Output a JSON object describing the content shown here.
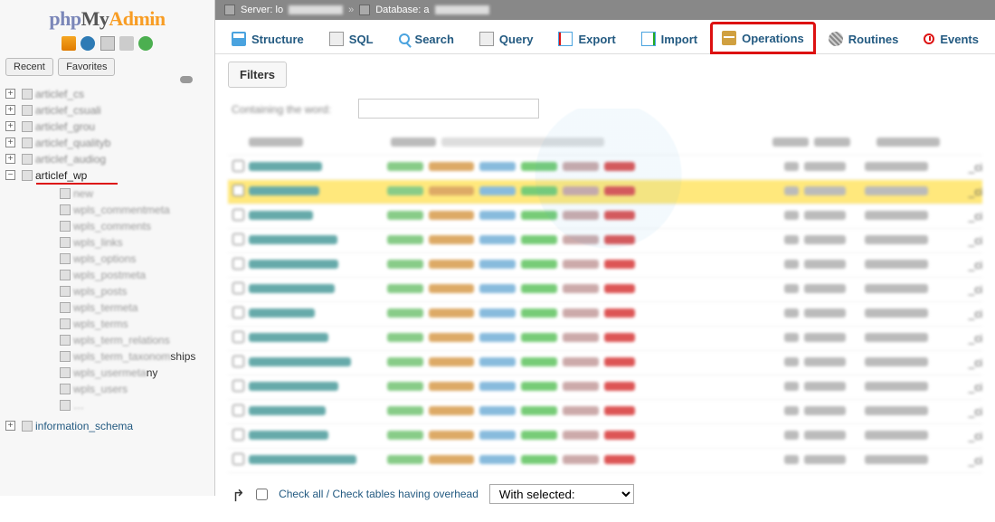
{
  "logo": {
    "php": "php",
    "my": "My",
    "admin": "Admin"
  },
  "sidebar": {
    "tabs": {
      "recent": "Recent",
      "favorites": "Favorites"
    },
    "blurred_dbs": [
      "articlef_cs",
      "articlef_csuali",
      "articlef_grou",
      "articlef_qualityb",
      "articlef_audiog"
    ],
    "selected_db": "articlef_wp",
    "child_blurred": [
      "new",
      "wpls_commentmeta",
      "wpls_comments",
      "wpls_links",
      "wpls_options",
      "wpls_postmeta",
      "wpls_posts",
      "wpls_termeta",
      "wpls_terms",
      "wpls_term_relations",
      "wpls_term_taxonom",
      "wpls_usermeta",
      "wpls_users"
    ],
    "child_clear_suffix": {
      "10": "ships",
      "11": "ny"
    },
    "info_schema": "information_schema"
  },
  "breadcrumb": {
    "server_label": "Server: lo",
    "db_label": "Database: a"
  },
  "tabs": {
    "structure": "Structure",
    "sql": "SQL",
    "search": "Search",
    "query": "Query",
    "export": "Export",
    "import": "Import",
    "operations": "Operations",
    "routines": "Routines",
    "events": "Events"
  },
  "filters": {
    "legend": "Filters",
    "containing_label": "Containing the word:",
    "containing_value": ""
  },
  "table": {
    "collation_tail": "_ci",
    "row_count": 13
  },
  "footer": {
    "checkall": "Check all / Check tables having overhead",
    "with_selected_placeholder": "With selected:"
  }
}
